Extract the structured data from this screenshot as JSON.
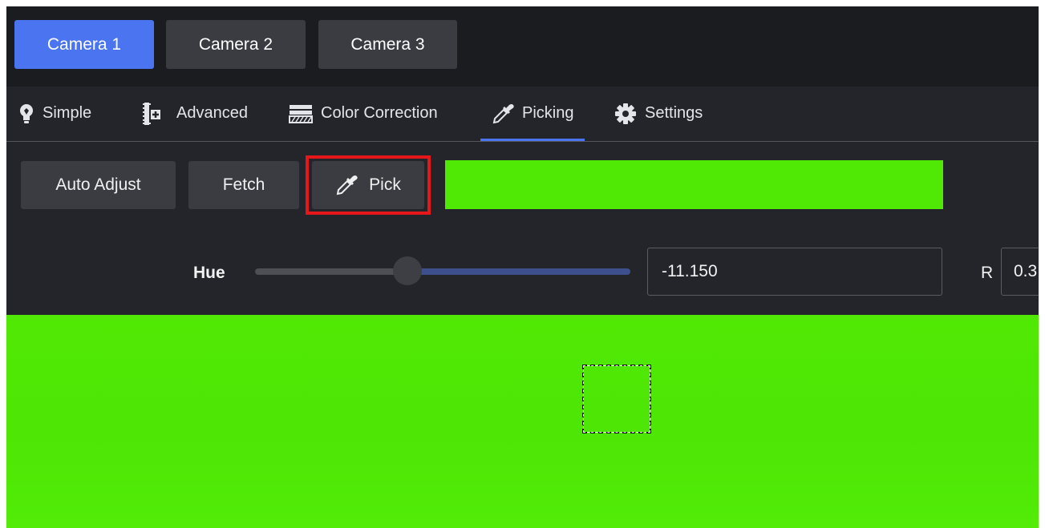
{
  "camera_tabs": [
    {
      "label": "Camera 1",
      "active": true
    },
    {
      "label": "Camera 2",
      "active": false
    },
    {
      "label": "Camera 3",
      "active": false
    }
  ],
  "nav": {
    "items": [
      {
        "label": "Simple",
        "icon": "lightbulb-icon"
      },
      {
        "label": "Advanced",
        "icon": "advanced-icon"
      },
      {
        "label": "Color Correction",
        "icon": "color-correction-icon"
      },
      {
        "label": "Picking",
        "icon": "eyedropper-icon",
        "active": true
      },
      {
        "label": "Settings",
        "icon": "gear-icon"
      }
    ]
  },
  "actions": {
    "auto_adjust_label": "Auto Adjust",
    "fetch_label": "Fetch",
    "pick_label": "Pick",
    "picked_color": "#4fe905"
  },
  "hue": {
    "label": "Hue",
    "value": "-11.150",
    "slider_fraction": 0.41
  },
  "rgb": {
    "r_label": "R",
    "r_value": "0.3"
  },
  "colors": {
    "accent": "#4a74f0",
    "highlight": "#e5171b",
    "screen_green": "#50e904"
  }
}
